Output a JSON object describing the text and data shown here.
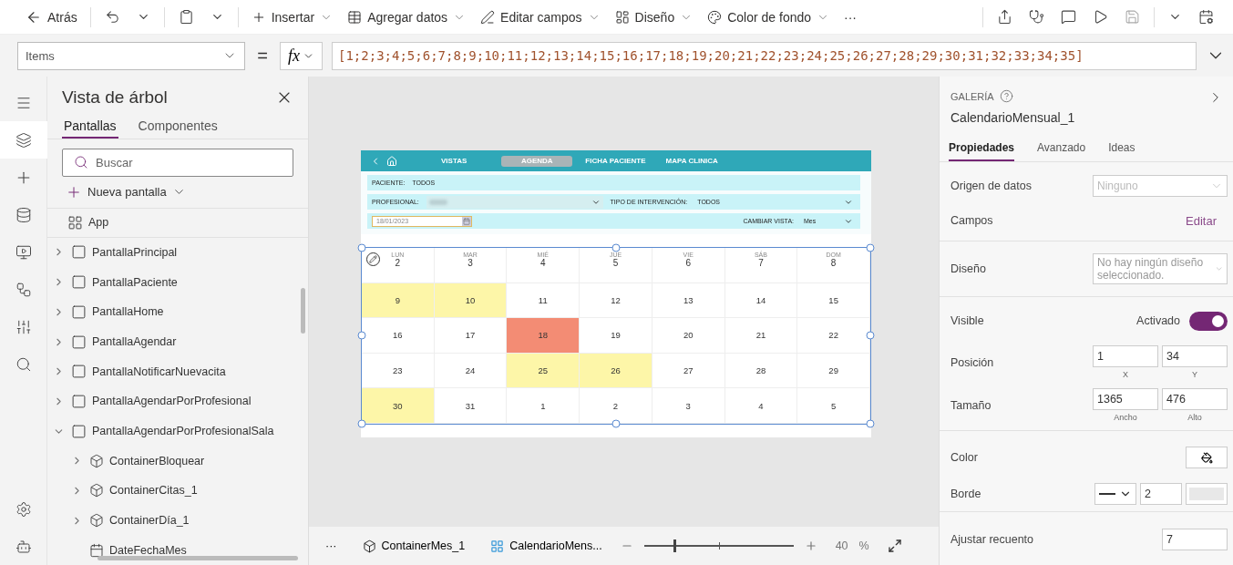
{
  "toolbar": {
    "back": "Atrás",
    "items": [
      {
        "kind": "insert",
        "label": "Insertar"
      },
      {
        "kind": "data",
        "label": "Agregar datos"
      },
      {
        "kind": "fields",
        "label": "Editar campos"
      },
      {
        "kind": "design",
        "label": "Diseño"
      },
      {
        "kind": "background",
        "label": "Color de fondo"
      }
    ],
    "more": "···"
  },
  "formula_bar": {
    "property": "Items",
    "equals": "=",
    "fx": "fx",
    "formula": "[1;2;3;4;5;6;7;8;9;10;11;12;13;14;15;16;17;18;19;20;21;22;23;24;25;26;27;28;29;30;31;32;33;34;35]"
  },
  "tree_view": {
    "title": "Vista de árbol",
    "tabs": [
      {
        "label": "Pantallas",
        "selected": true
      },
      {
        "label": "Componentes",
        "selected": false
      }
    ],
    "search": {
      "placeholder": "Buscar"
    },
    "new_screen": "Nueva pantalla",
    "app": "App",
    "items": [
      {
        "kind": "screen",
        "label": "PantallaPrincipal",
        "expanded": false
      },
      {
        "kind": "screen",
        "label": "PantallaPaciente",
        "expanded": false
      },
      {
        "kind": "screen",
        "label": "PantallaHome",
        "expanded": false
      },
      {
        "kind": "screen",
        "label": "PantallaAgendar",
        "expanded": false
      },
      {
        "kind": "screen",
        "label": "PantallaNotificarNuevacita",
        "expanded": false
      },
      {
        "kind": "screen",
        "label": "PantallaAgendarPorProfesional",
        "expanded": false
      },
      {
        "kind": "screen",
        "label": "PantallaAgendarPorProfesionalSala",
        "expanded": true,
        "children": [
          {
            "kind": "container",
            "label": "ContainerBloquear",
            "expanded": false
          },
          {
            "kind": "container",
            "label": "ContainerCitas_1",
            "expanded": false
          },
          {
            "kind": "container",
            "label": "ContainerDía_1",
            "expanded": false
          },
          {
            "kind": "date",
            "label": "DateFechaMes"
          }
        ]
      }
    ]
  },
  "app_screen": {
    "nav": [
      {
        "label": "VISTAS",
        "selected": false
      },
      {
        "label": "AGENDA",
        "selected": true
      },
      {
        "label": "FICHA PACIENTE",
        "selected": false
      },
      {
        "label": "MAPA CLINICA",
        "selected": false
      }
    ],
    "patient_label": "PACIENTE:",
    "patient_value": "TODOS",
    "professional_label": "PROFESIONAL:",
    "intervention_label": "TIPO DE INTERVENCIÓN:",
    "intervention_value": "TODOS",
    "date": "18/01/2023",
    "view_label": "CAMBIAR VISTA:",
    "view_value": "Mes",
    "calendar": {
      "header": [
        {
          "day": "LUN",
          "number": "2"
        },
        {
          "day": "MAR",
          "number": "3"
        },
        {
          "day": "MIÉ",
          "number": "4"
        },
        {
          "day": "JUE",
          "number": "5"
        },
        {
          "day": "VIE",
          "number": "6"
        },
        {
          "day": "SÁB",
          "number": "7"
        },
        {
          "day": "DOM",
          "number": "8"
        }
      ],
      "weeks": [
        [
          {
            "day": "9",
            "color": "#fdf6a8"
          },
          {
            "day": "10",
            "color": "#fdf6a8"
          },
          {
            "day": "11",
            "color": "#ffffff"
          },
          {
            "day": "12",
            "color": "#ffffff"
          },
          {
            "day": "13",
            "color": "#ffffff"
          },
          {
            "day": "14",
            "color": "#ffffff"
          },
          {
            "day": "15",
            "color": "#ffffff"
          }
        ],
        [
          {
            "day": "16",
            "color": "#ffffff"
          },
          {
            "day": "17",
            "color": "#ffffff"
          },
          {
            "day": "18",
            "color": "#f38c74"
          },
          {
            "day": "19",
            "color": "#ffffff"
          },
          {
            "day": "20",
            "color": "#ffffff"
          },
          {
            "day": "21",
            "color": "#ffffff"
          },
          {
            "day": "22",
            "color": "#ffffff"
          }
        ],
        [
          {
            "day": "23",
            "color": "#ffffff"
          },
          {
            "day": "24",
            "color": "#ffffff"
          },
          {
            "day": "25",
            "color": "#fdf6a8"
          },
          {
            "day": "26",
            "color": "#fdf6a8"
          },
          {
            "day": "27",
            "color": "#ffffff"
          },
          {
            "day": "28",
            "color": "#ffffff"
          },
          {
            "day": "29",
            "color": "#ffffff"
          }
        ],
        [
          {
            "day": "30",
            "color": "#fdf6a8"
          },
          {
            "day": "31",
            "color": "#ffffff"
          },
          {
            "day": "1",
            "color": "#ffffff"
          },
          {
            "day": "2",
            "color": "#ffffff"
          },
          {
            "day": "3",
            "color": "#ffffff"
          },
          {
            "day": "4",
            "color": "#ffffff"
          },
          {
            "day": "5",
            "color": "#ffffff"
          }
        ]
      ]
    }
  },
  "bottom_bar": {
    "more": "···",
    "breadcrumbs": [
      {
        "kind": "container",
        "label": "ContainerMes_1"
      },
      {
        "kind": "gallery",
        "label": "CalendarioMens..."
      }
    ],
    "zoom": {
      "level": 0.2
    },
    "zoom_value": "40",
    "zoom_unit": "%"
  },
  "properties": {
    "type": "GALERÍA",
    "name": "CalendarioMensual_1",
    "tabs": [
      {
        "label": "Propiedades",
        "selected": true
      },
      {
        "label": "Avanzado",
        "selected": false
      },
      {
        "label": "Ideas",
        "selected": false
      }
    ],
    "sections": [
      [
        {
          "kind": "dropdown",
          "label": "Origen de datos",
          "value": "Ninguno",
          "disabled": true
        },
        {
          "kind": "link",
          "label": "Campos",
          "value": "Editar"
        }
      ],
      [
        {
          "kind": "dropdown",
          "label": "Diseño",
          "placeholder": "No hay ningún diseño seleccionado.",
          "disabled": false
        }
      ],
      [
        {
          "kind": "toggle",
          "label": "Visible",
          "value": "Activado",
          "on": true
        },
        {
          "kind": "pair",
          "label": "Posición",
          "values": [
            "1",
            "34"
          ],
          "captions": [
            "X",
            "Y"
          ]
        },
        {
          "kind": "pair",
          "label": "Tamaño",
          "values": [
            "1365",
            "476"
          ],
          "captions": [
            "Ancho",
            "Alto"
          ]
        }
      ],
      [
        {
          "kind": "color",
          "label": "Color"
        },
        {
          "kind": "border",
          "label": "Borde",
          "value": "2"
        }
      ],
      [
        {
          "kind": "input",
          "label": "Ajustar recuento",
          "value": "7"
        }
      ]
    ]
  }
}
